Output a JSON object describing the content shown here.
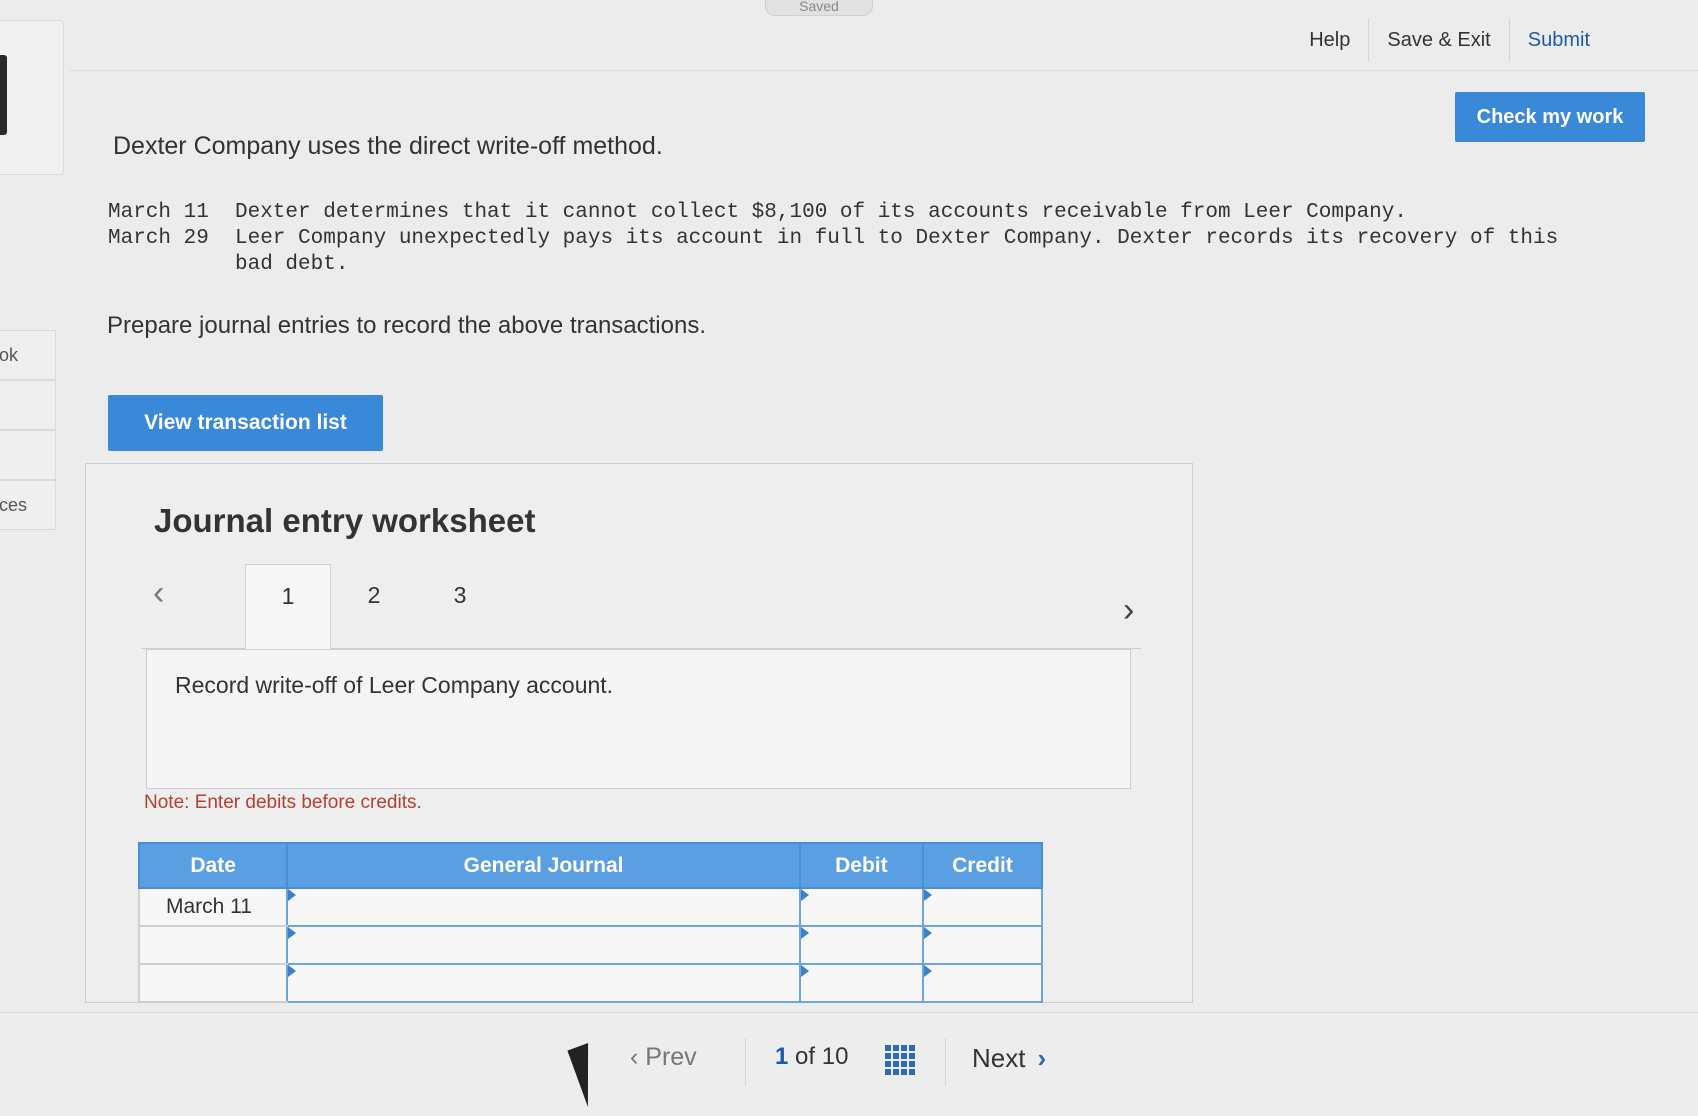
{
  "status": {
    "saved": "Saved"
  },
  "top_nav": {
    "help": "Help",
    "save_exit": "Save & Exit",
    "submit": "Submit"
  },
  "check_button": "Check my work",
  "left_rail": {
    "item1": "ok",
    "item2": "ces"
  },
  "question": {
    "intro": "Dexter Company uses the direct write-off method.",
    "transactions": [
      {
        "date": "March 11",
        "text": "Dexter determines that it cannot collect $8,100 of its accounts receivable from Leer Company."
      },
      {
        "date": "March 29",
        "text": "Leer Company unexpectedly pays its account in full to Dexter Company. Dexter records its recovery of this bad debt."
      }
    ],
    "instruction": "Prepare journal entries to record the above transactions."
  },
  "view_button": "View transaction list",
  "worksheet": {
    "title": "Journal entry worksheet",
    "tabs": [
      "1",
      "2",
      "3"
    ],
    "active_tab": "1",
    "description": "Record write-off of Leer Company account.",
    "note": "Note: Enter debits before credits.",
    "columns": {
      "date": "Date",
      "journal": "General Journal",
      "debit": "Debit",
      "credit": "Credit"
    },
    "rows": [
      {
        "date": "March 11"
      },
      {
        "date": ""
      },
      {
        "date": ""
      }
    ]
  },
  "pagination": {
    "prev": "Prev",
    "current": "1",
    "of_label": "of 10",
    "next": "Next"
  }
}
